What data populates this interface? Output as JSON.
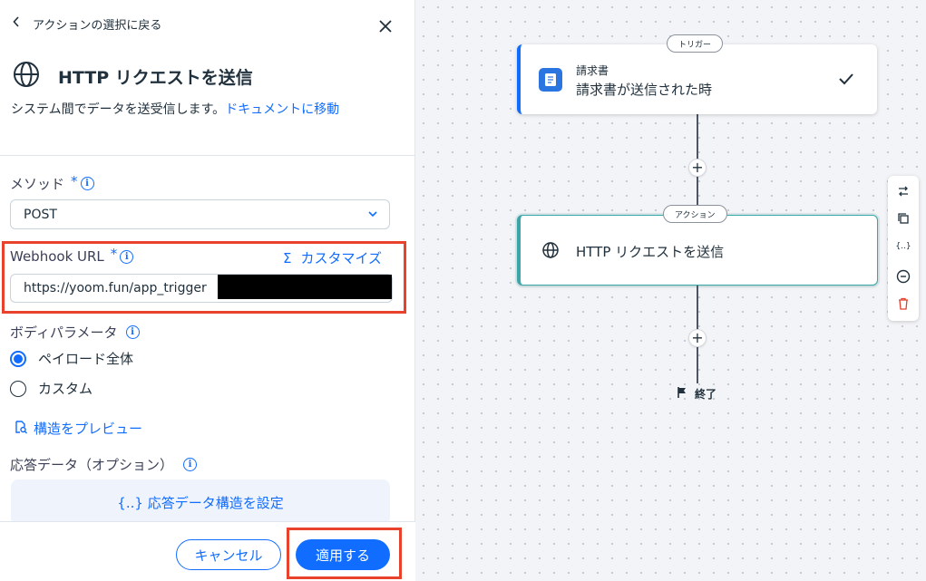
{
  "panel": {
    "back_label": "アクションの選択に戻る",
    "title": "HTTP リクエストを送信",
    "description": "システム間でデータを送受信します。",
    "doc_link": "ドキュメントに移動",
    "method": {
      "label": "メソッド",
      "required_mark": "*",
      "value": "POST"
    },
    "webhook": {
      "label": "Webhook URL",
      "required_mark": "*",
      "customize_label": "カスタマイズ",
      "url_value": "https://yoom.fun/app_trigger"
    },
    "body": {
      "label": "ボディパラメータ",
      "options": [
        {
          "label": "ペイロード全体",
          "selected": true
        },
        {
          "label": "カスタム",
          "selected": false
        }
      ]
    },
    "preview_link": "構造をプレビュー",
    "response": {
      "label": "応答データ（オプション）",
      "button_label": "{..} 応答データ構造を設定"
    },
    "footer": {
      "cancel_label": "キャンセル",
      "apply_label": "適用する"
    }
  },
  "canvas": {
    "trigger": {
      "pill": "トリガー",
      "app_name": "請求書",
      "event": "請求書が送信された時"
    },
    "action": {
      "pill": "アクション",
      "label": "HTTP リクエストを送信"
    },
    "plus_symbol": "+",
    "end_label": "終了",
    "toolbar": {
      "variables_label": "{..}"
    }
  },
  "colors": {
    "accent": "#116dff",
    "highlight": "#e8412c",
    "action_border": "#3aa6a8",
    "delete": "#e0412e"
  }
}
